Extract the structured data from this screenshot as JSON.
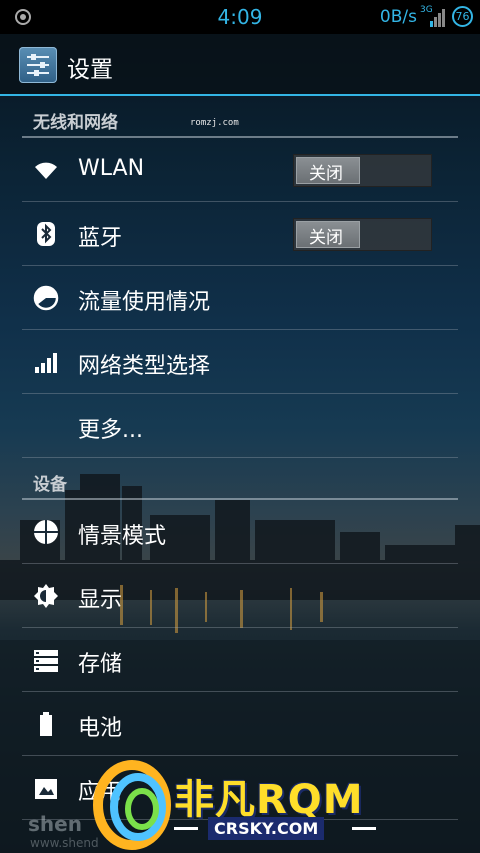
{
  "status_bar": {
    "time": "4:09",
    "speed": "0B/s",
    "network": "3G",
    "battery": "76",
    "accent": "#33b5e5"
  },
  "action_bar": {
    "icon": "settings-sliders-icon",
    "title": "设置"
  },
  "sections": [
    {
      "title": "无线和网络",
      "overlay_text": "romzj.com",
      "items": [
        {
          "icon": "wifi-icon",
          "label": "WLAN",
          "toggle": "关闭"
        },
        {
          "icon": "bluetooth-icon",
          "label": "蓝牙",
          "toggle": "关闭"
        },
        {
          "icon": "data-usage-icon",
          "label": "流量使用情况"
        },
        {
          "icon": "signal-bars-icon",
          "label": "网络类型选择"
        },
        {
          "icon": "",
          "label": "更多..."
        }
      ]
    },
    {
      "title": "设备",
      "items": [
        {
          "icon": "profile-mode-icon",
          "label": "情景模式"
        },
        {
          "icon": "brightness-icon",
          "label": "显示"
        },
        {
          "icon": "storage-icon",
          "label": "存储"
        },
        {
          "icon": "battery-icon",
          "label": "电池"
        },
        {
          "icon": "apps-icon",
          "label": "应用"
        }
      ]
    }
  ],
  "watermarks": {
    "brand": "非凡RQM",
    "site": "CRSKY.COM",
    "left_text": "shen",
    "left_sub": "www.shend"
  }
}
